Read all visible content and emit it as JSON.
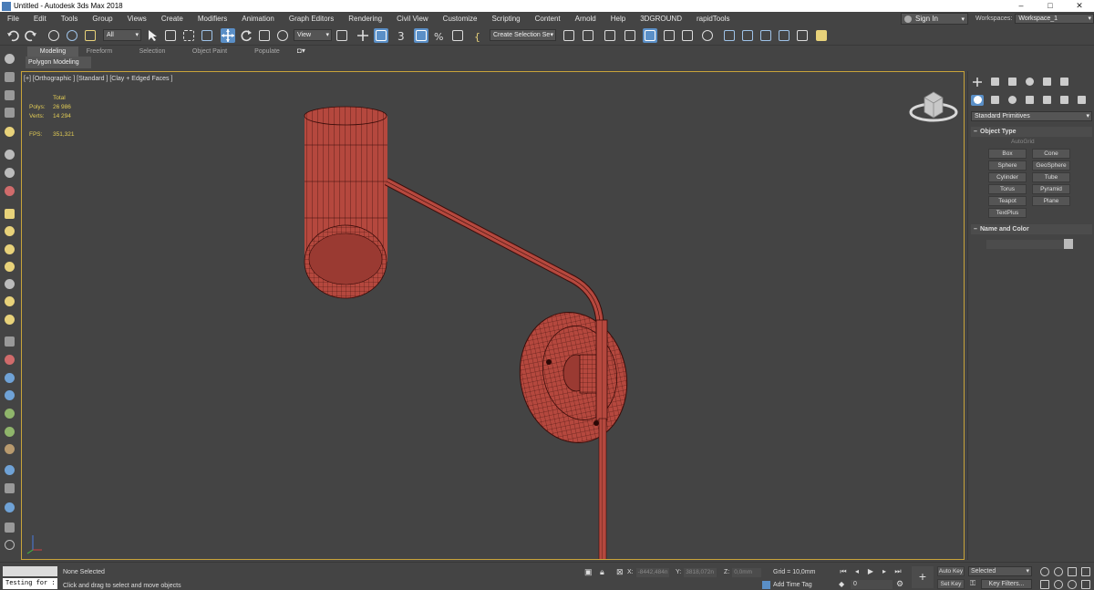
{
  "window": {
    "title": "Untitled - Autodesk 3ds Max 2018",
    "buttons": [
      "–",
      "□",
      "✕"
    ]
  },
  "menu": [
    "File",
    "Edit",
    "Tools",
    "Group",
    "Views",
    "Create",
    "Modifiers",
    "Animation",
    "Graph Editors",
    "Rendering",
    "Civil View",
    "Customize",
    "Scripting",
    "Content",
    "Arnold",
    "Help",
    "3DGROUND",
    "rapidTools"
  ],
  "account": {
    "signin": "Sign In",
    "workspaces_label": "Workspaces:",
    "workspace": "Workspace_1"
  },
  "toolbar": {
    "selection_filter": "All",
    "reference_coord": "View",
    "named_selection": "Create Selection Se"
  },
  "ribbon": {
    "tabs": [
      "Modeling",
      "Freeform",
      "Selection",
      "Object Paint",
      "Populate"
    ],
    "active_tab": "Modeling",
    "panel": "Polygon Modeling"
  },
  "viewport": {
    "label": "[+] [Orthographic ] [Standard ] [Clay + Edged Faces ]",
    "stats": {
      "header": "Total",
      "polys_label": "Polys:",
      "polys": "26 986",
      "verts_label": "Verts:",
      "verts": "14 294",
      "fps_label": "FPS:",
      "fps": "351,321"
    }
  },
  "command_panel": {
    "category": "Standard Primitives",
    "object_type_title": "Object Type",
    "autogrid": "AutoGrid",
    "objects": [
      "Box",
      "Cone",
      "Sphere",
      "GeoSphere",
      "Cylinder",
      "Tube",
      "Torus",
      "Pyramid",
      "Teapot",
      "Plane",
      "TextPlus"
    ],
    "name_color_title": "Name and Color"
  },
  "status": {
    "maxscript_output": "Testing for :",
    "selection": "None Selected",
    "prompt": "Click and drag to select and move objects",
    "x_label": "X:",
    "x": "-8442,484n",
    "y_label": "Y:",
    "y": "3818,072n",
    "z_label": "Z:",
    "z": "0,0mm",
    "grid": "Grid = 10,0mm",
    "add_time_tag": "Add Time Tag",
    "frame": "0",
    "auto_key": "Auto Key",
    "set_key": "Set Key",
    "selected": "Selected",
    "key_filters": "Key Filters..."
  },
  "colors": {
    "model": "#b5483e",
    "wire": "#3a0d0a",
    "viewport_border": "#c9a43a",
    "accent": "#5a8fc7",
    "stats": "#e3cd55"
  }
}
